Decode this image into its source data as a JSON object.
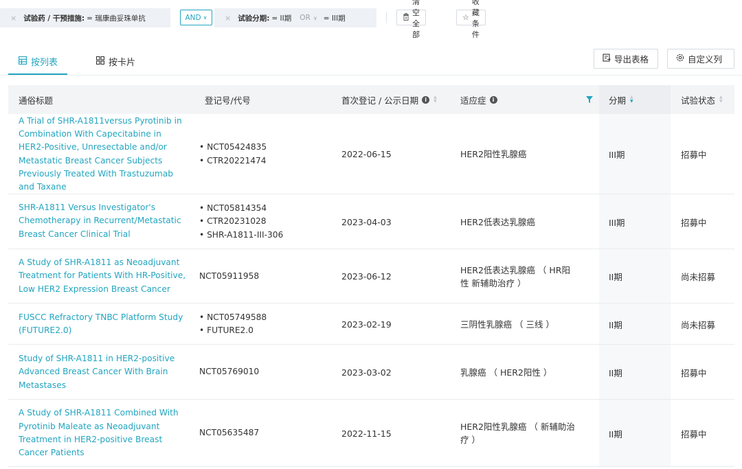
{
  "filters": {
    "chip1": {
      "remove_icon": "×",
      "key": "试验药 / 干预措施:",
      "value": "= 瑞康曲妥珠单抗"
    },
    "logic_operator": {
      "label": "AND",
      "caret": "∨"
    },
    "chip2": {
      "remove_icon": "×",
      "key": "试验分期:",
      "value1": "= II期",
      "operator": "OR",
      "operator_caret": "∨",
      "value2": "= III期"
    },
    "clear_all_label": "清空全部",
    "favorite_label": "收藏条件"
  },
  "tabs": {
    "list_view": "按列表",
    "card_view": "按卡片",
    "active": "list_view"
  },
  "actions": {
    "export_label": "导出表格",
    "customize_label": "自定义列"
  },
  "columns": {
    "title": "通俗标题",
    "registration": "登记号/代号",
    "first_date": "首次登记 / 公示日期",
    "indication": "适应症",
    "phase": "分期",
    "status": "试验状态"
  },
  "rows": [
    {
      "title": "A Trial of SHR-A1811versus Pyrotinib in Combination With Capecitabine in HER2-Positive, Unresectable and/or Metastatic Breast Cancer Subjects Previously Treated With Trastuzumab and Taxane",
      "registrations": [
        "• NCT05424835",
        "• CTR20221474"
      ],
      "date": "2022-06-15",
      "indication": "HER2阳性乳腺癌",
      "phase": "III期",
      "status": "招募中"
    },
    {
      "title": "SHR-A1811 Versus Investigator's Chemotherapy in Recurrent/Metastatic Breast Cancer Clinical Trial",
      "registrations": [
        "• NCT05814354",
        "• CTR20231028",
        "• SHR-A1811-III-306"
      ],
      "date": "2023-04-03",
      "indication": "HER2低表达乳腺癌",
      "phase": "III期",
      "status": "招募中"
    },
    {
      "title": "A Study of SHR-A1811 as Neoadjuvant Treatment for Patients With HR-Positive, Low HER2 Expression Breast Cancer",
      "registrations": [
        "NCT05911958"
      ],
      "date": "2023-06-12",
      "indication": "HER2低表达乳腺癌 （ HR阳性 新辅助治疗 ）",
      "phase": "II期",
      "status": "尚未招募"
    },
    {
      "title": "FUSCC Refractory TNBC Platform Study (FUTURE2.0)",
      "registrations": [
        "• NCT05749588",
        "• FUTURE2.0"
      ],
      "date": "2023-02-19",
      "indication": "三阴性乳腺癌 （ 三线 ）",
      "phase": "II期",
      "status": "尚未招募"
    },
    {
      "title": "Study of SHR-A1811 in HER2-positive Advanced Breast Cancer With Brain Metastases",
      "registrations": [
        "NCT05769010"
      ],
      "date": "2023-03-02",
      "indication": "乳腺癌 （ HER2阳性 ）",
      "phase": "II期",
      "status": "招募中"
    },
    {
      "title": "A Study of SHR-A1811 Combined With Pyrotinib Maleate as Neoadjuvant Treatment in HER2-positive Breast Cancer Patients",
      "registrations": [
        "NCT05635487"
      ],
      "date": "2022-11-15",
      "indication": "HER2阳性乳腺癌 （ 新辅助治疗 ）",
      "phase": "II期",
      "status": "招募中"
    }
  ],
  "colors": {
    "accent": "#23a5c0",
    "header_bg": "#f3f4f6",
    "chip_bg": "#eef1f5"
  }
}
